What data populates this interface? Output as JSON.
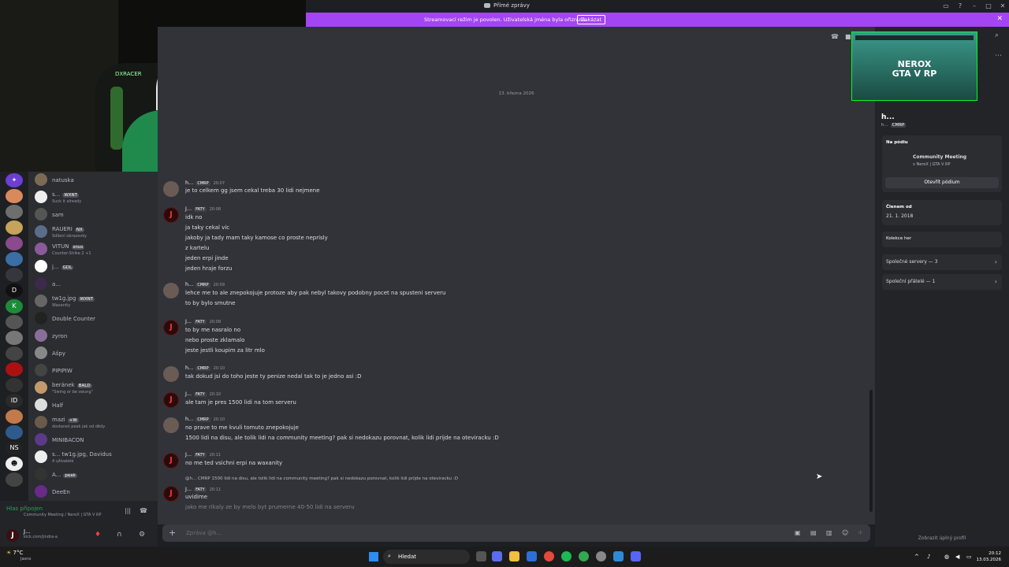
{
  "window": {
    "title": "Přímé zprávy"
  },
  "banner": {
    "text": "Streamovací režim je povolen. Uživatelská jména byla ořiznuta.",
    "button": "Zakázat"
  },
  "webcam": {
    "brand": "DXRACER"
  },
  "dm_list": [
    {
      "name": "natuska",
      "badge": "",
      "status": ""
    },
    {
      "name": "s...",
      "badge": "WXNT",
      "status": "Suck it already"
    },
    {
      "name": "sam",
      "badge": "",
      "status": ""
    },
    {
      "name": "RAUERI",
      "badge": "NX",
      "status": "Sdílení obrazovky"
    },
    {
      "name": "VITUN",
      "badge": "snus",
      "status": "Counter-Strike 2 +1"
    },
    {
      "name": "j...",
      "badge": "GDL",
      "status": ""
    },
    {
      "name": "a...",
      "badge": "",
      "status": ""
    },
    {
      "name": "tw1g.jpg",
      "badge": "WXNT",
      "status": "Waxanity"
    },
    {
      "name": "Double Counter",
      "badge": "",
      "status": ""
    },
    {
      "name": "zyron",
      "badge": "",
      "status": ""
    },
    {
      "name": "Ašpy",
      "badge": "",
      "status": ""
    },
    {
      "name": "PIPIPIW",
      "badge": "",
      "status": ""
    },
    {
      "name": "beránek",
      "badge": "BALD",
      "status": "\"Swing or be swung\""
    },
    {
      "name": "Half",
      "badge": "",
      "status": ""
    },
    {
      "name": "mazi",
      "badge": "+W",
      "status": "dostaneš peak jak od dědy"
    },
    {
      "name": "MINIBACON",
      "badge": "",
      "status": ""
    },
    {
      "name": "s... tw1g.jpg, Davidus",
      "badge": "",
      "status": "4 uživatelé"
    },
    {
      "name": "A...",
      "badge": "peak",
      "status": ""
    },
    {
      "name": "DeeEn",
      "badge": "",
      "status": ""
    }
  ],
  "voice": {
    "status": "Hlas připojen",
    "channel": "Community Meeting / NeroX | GTA V RP"
  },
  "user": {
    "name": "J...",
    "status": "kick.com/jindra-a"
  },
  "chat": {
    "date": "13. března 2026",
    "composer_placeholder": "Zpráva @h...",
    "messages": [
      {
        "author": "h...",
        "tag": "CMRP",
        "time": "20:07",
        "lines": [
          "je to celkem gg jsem cekal treba 30 lidi nejmene"
        ]
      },
      {
        "author": "J...",
        "tag": "FATY",
        "time": "20:08",
        "lines": [
          "idk no",
          "ja taky cekal vic",
          "jakoby ja tady mam taky kamose co proste neprisly",
          "z kartelu",
          "jeden erpi jinde",
          "jeden hraje forzu"
        ]
      },
      {
        "author": "h...",
        "tag": "CMRP",
        "time": "20:09",
        "lines": [
          "lehce me to ale znepokojuje protoze aby pak nebyl takovy podobny pocet na spusteni serveru",
          "to by bylo smutne"
        ]
      },
      {
        "author": "J...",
        "tag": "FATY",
        "time": "20:09",
        "lines": [
          "to by me nasralo no",
          "nebo proste zklamalo",
          "jeste jestli koupim za litr mlo"
        ]
      },
      {
        "author": "h...",
        "tag": "CMRP",
        "time": "20:10",
        "lines": [
          "tak dokud jsi do toho jeste ty penize nedal tak to je jedno asi :D"
        ]
      },
      {
        "author": "J...",
        "tag": "FATY",
        "time": "20:10",
        "lines": [
          "ale tam je pres 1500 lidi na tom serveru"
        ]
      },
      {
        "author": "h...",
        "tag": "CMRP",
        "time": "20:10",
        "lines": [
          "no prave to me kvuli tomuto znepokojuje",
          "1500 lidi na disu, ale tolik lidi na community meeting? pak si nedokazu porovnat, kolik lidi prijde na oteviracku :D"
        ]
      },
      {
        "author": "J...",
        "tag": "FATY",
        "time": "20:11",
        "lines": [
          "no me ted vsichni erpi na waxanity"
        ]
      },
      {
        "author": "J...",
        "tag": "FATY",
        "time": "20:11",
        "reply": "@h... CMRP 1500 lidi na disu, ale tolik lidi na community meeting? pak si nedokazu porovnat, kolik lidi prijde na oteviracku :D",
        "lines": [
          "uvidime"
        ]
      }
    ],
    "pending_line": "jako me rikaly ze by melo byt prumerne 40-50 lidi na serveru"
  },
  "profile": {
    "banner_title_1": "NEROX",
    "banner_title_2": "GTA V RP",
    "name": "h...",
    "sub": "h...",
    "tag": "CMRP",
    "stage_label": "Na pódiu",
    "stage_event": "Community Meeting",
    "stage_server": "v NeroX | GTA V RP",
    "stage_button": "Otevřít pódium",
    "member_label": "Členem od",
    "member_date": "21. 1. 2018",
    "games_label": "Kolekce her",
    "mutual_servers": "Společné servery — 3",
    "mutual_friends": "Společní přátelé — 1",
    "full_profile": "Zobrazit úplný profil"
  },
  "taskbar": {
    "weather_temp": "7°C",
    "weather_desc": "Jasno",
    "search": "Hledat",
    "time": "20:12",
    "date": "13.03.2026"
  }
}
